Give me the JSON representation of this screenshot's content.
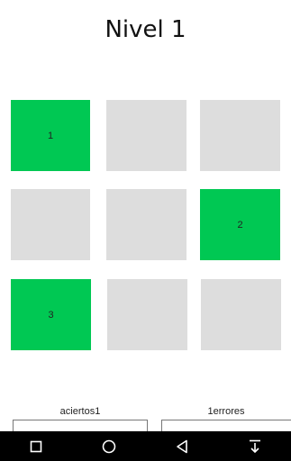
{
  "header": {
    "title": "Nivel 1"
  },
  "grid": {
    "tiles": [
      {
        "label": "1",
        "state": "active"
      },
      {
        "label": "",
        "state": "inactive"
      },
      {
        "label": "",
        "state": "inactive"
      },
      {
        "label": "",
        "state": "inactive"
      },
      {
        "label": "",
        "state": "inactive"
      },
      {
        "label": "2",
        "state": "active"
      },
      {
        "label": "3",
        "state": "active"
      },
      {
        "label": "",
        "state": "inactive"
      },
      {
        "label": "",
        "state": "inactive"
      }
    ],
    "active_color": "#00c853",
    "inactive_color": "#dddddd"
  },
  "stats": {
    "hits_label": "aciertos1",
    "errors_label": "1errores"
  },
  "navbar": {
    "icons": [
      "square-icon",
      "circle-icon",
      "back-triangle-icon",
      "download-icon"
    ]
  }
}
